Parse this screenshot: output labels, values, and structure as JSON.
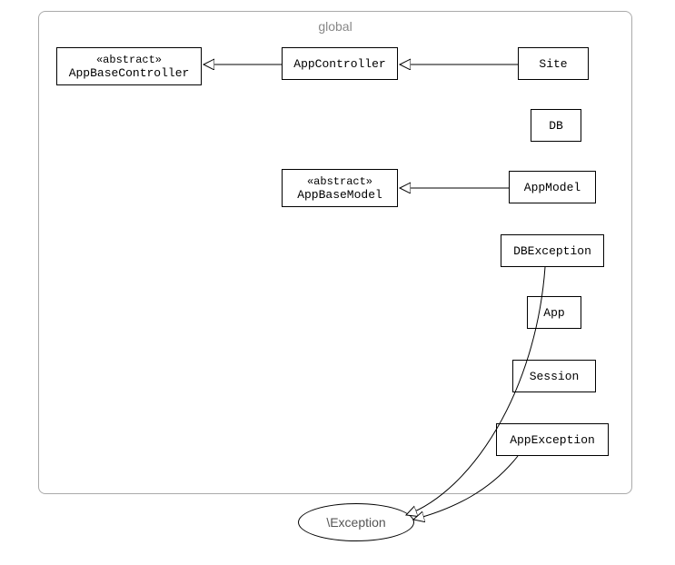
{
  "package": {
    "title": "global"
  },
  "classes": {
    "appBaseController": {
      "stereotype": "«abstract»",
      "name": "AppBaseController"
    },
    "appController": {
      "name": "AppController"
    },
    "site": {
      "name": "Site"
    },
    "db": {
      "name": "DB"
    },
    "appBaseModel": {
      "stereotype": "«abstract»",
      "name": "AppBaseModel"
    },
    "appModel": {
      "name": "AppModel"
    },
    "dbException": {
      "name": "DBException"
    },
    "app": {
      "name": "App"
    },
    "session": {
      "name": "Session"
    },
    "appException": {
      "name": "AppException"
    }
  },
  "external": {
    "exception": "\\Exception"
  }
}
